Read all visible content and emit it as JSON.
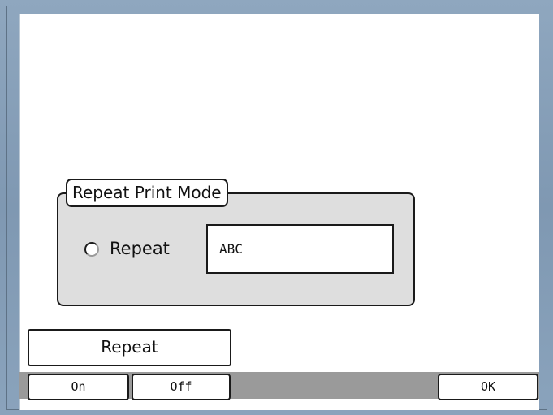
{
  "group": {
    "title": "Repeat Print Mode",
    "radio_label": "Repeat",
    "radio_selected": false,
    "text_value": "ABC"
  },
  "repeat_button": {
    "label": "Repeat"
  },
  "softkeys": {
    "on": "On",
    "off": "Off",
    "ok": "OK"
  },
  "colors": {
    "frame": "#8fa7bf",
    "group_background": "#dedede",
    "softkey_bar": "#9a9a9a",
    "border": "#1a1a1a"
  }
}
